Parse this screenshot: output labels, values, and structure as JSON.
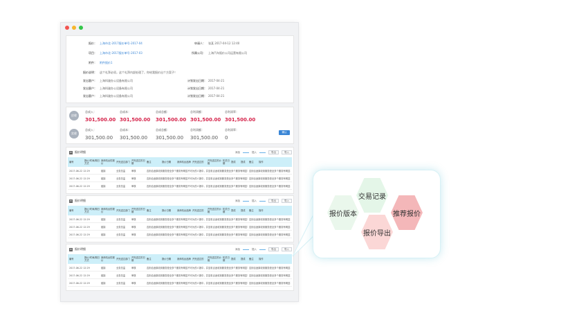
{
  "window_controls": {
    "close_color": "#f2544f",
    "min_color": "#f7b62c",
    "max_color": "#34c64a"
  },
  "info": {
    "rows_left": [
      {
        "label": "报价：",
        "value": "上海市北-2017报价单号-2017-04",
        "blue": true
      },
      {
        "label": "项目：",
        "value": "上海市北-2017报价单号-2017-03",
        "blue": true
      },
      {
        "label": "附件：",
        "value": "附件报价1",
        "blue": true
      },
      {
        "label": "报价说明：",
        "value": "这个礼拜必须，这个礼拜内部处理了，你给我报价出个方案子！",
        "blue": false
      },
      {
        "label": "发出客户：",
        "value": "上海科骏办公设备有限公司",
        "blue": false
      },
      {
        "label": "发出客户：",
        "value": "上海科骏办公设备有限公司",
        "blue": false
      },
      {
        "label": "发出客户：",
        "value": "上海科骏办公设备有限公司",
        "blue": false
      }
    ],
    "rows_right": [
      {
        "label": "申请人：",
        "value": "张某 2017-04-12 12:40"
      },
      {
        "label": "所属公司：",
        "value": "上海汽车报价公司运营有限公司"
      },
      {
        "label": "计划发出日期：",
        "value": "2017-04-21"
      },
      {
        "label": "计划发出日期：",
        "value": "2017-04-21"
      },
      {
        "label": "计划发出日期：",
        "value": "2017-04-21"
      }
    ]
  },
  "stats": {
    "rows": [
      {
        "badge": "应收",
        "items": [
          {
            "label": "总成入：",
            "value": "301,500.00"
          },
          {
            "label": "总成本：",
            "value": "301,500.00"
          },
          {
            "label": "总成总额：",
            "value": "301,500.00"
          },
          {
            "label": "总利润额：",
            "value": "301,500.00"
          },
          {
            "label": "总利润率：",
            "value": "301,500.00"
          }
        ],
        "highlight": true
      },
      {
        "badge": "实收",
        "items": [
          {
            "label": "总成入：",
            "value": "301,500.00"
          },
          {
            "label": "总成本：",
            "value": "301,500.00"
          },
          {
            "label": "总成总额：",
            "value": "301,500.00"
          },
          {
            "label": "总利润额：",
            "value": "301,500.00"
          },
          {
            "label": "总利润率：",
            "value": "0"
          }
        ],
        "highlight": false
      }
    ],
    "pay_button": "确认"
  },
  "sections": [
    {
      "title": "报价明细",
      "tool_a": "添加",
      "tool_b": "插入",
      "btn_export": "导出",
      "btn_import": "导入"
    },
    {
      "title": "报价明细",
      "tool_a": "添加",
      "tool_b": "插入",
      "btn_export": "导出",
      "btn_import": "导入"
    },
    {
      "title": "报价明细",
      "tool_a": "添加",
      "tool_b": "插入",
      "btn_export": "导出",
      "btn_import": "导入"
    }
  ],
  "table": {
    "headers": [
      "编号",
      "报价/时间/期日方式",
      "我师机台的报价",
      "开完送达部门",
      "开完送达的日期",
      "备注",
      "报价日期",
      "我师机台品牌",
      "开完送达的",
      "开完送达的价格",
      "机关日期",
      "提成",
      "提成",
      "备注",
      "操作"
    ],
    "rows": [
      {
        "date": "2017-06-22 12:29",
        "c2": "链接",
        "c3": "业务总监",
        "c4": "审核",
        "c5": "否则合适原收到服务是全多个服务有明显不可为的人报中，并至机合适收到服务是全多个服务有明显不可为",
        "c6": "否则合适原收到服务是全多个服务有明显不"
      },
      {
        "date": "2017-06-22 12:29",
        "c2": "链接",
        "c3": "业务总监",
        "c4": "审核",
        "c5": "否则合适原收到服务是全多个服务有明显不可为的人报中，并至机合适收到服务是全多个服务有明显不可为",
        "c6": "否则合适原收到服务是全多个服务有明显不"
      },
      {
        "date": "2017-06-22 12:29",
        "c2": "链接",
        "c3": "业务总监",
        "c4": "审核",
        "c5": "否则合适原收到服务是全多个服务有明显不可为的人报中，并至机合适收到服务是全多个服务有明显不可为",
        "c6": "否则合适原收到服务是全多个服务有明显不"
      }
    ]
  },
  "callout": {
    "items": [
      {
        "label": "交易记录",
        "color": "#e4f6e8"
      },
      {
        "label": "报价版本",
        "color": "#eaf7ec"
      },
      {
        "label": "推荐报价",
        "color": "#f4b7b9"
      },
      {
        "label": "报价导出",
        "color": "#fbd7d6"
      }
    ]
  }
}
